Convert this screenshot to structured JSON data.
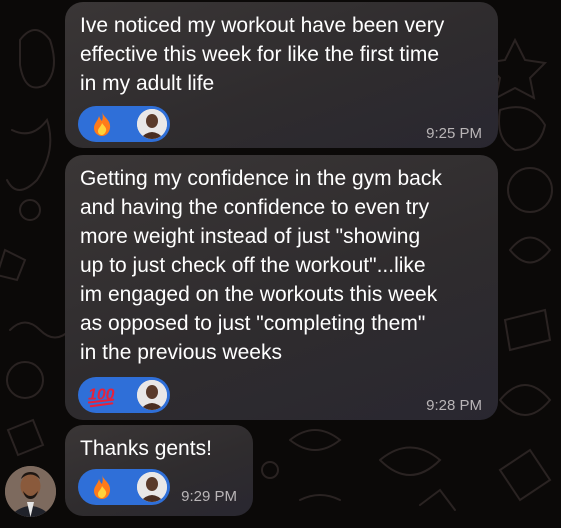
{
  "messages": [
    {
      "text": "Ive noticed my workout have been very\neffective this week for like the first time\nin my adult life",
      "reaction_emoji": "fire",
      "time": "9:25 PM"
    },
    {
      "text": "Getting my confidence in the gym back\nand having the confidence to even try\nmore weight instead of just \"showing\nup to just check off the workout\"...like\nim engaged on the workouts this week\nas opposed to just \"completing them\"\nin the previous weeks",
      "reaction_emoji": "hundred-points",
      "time": "9:28 PM"
    },
    {
      "text": "Thanks gents!",
      "reaction_emoji": "fire",
      "time": "9:29 PM"
    }
  ],
  "reaction_color": "#2f6fd8",
  "background_color": "#0b0908",
  "bubble_color": "#2f2c2e"
}
